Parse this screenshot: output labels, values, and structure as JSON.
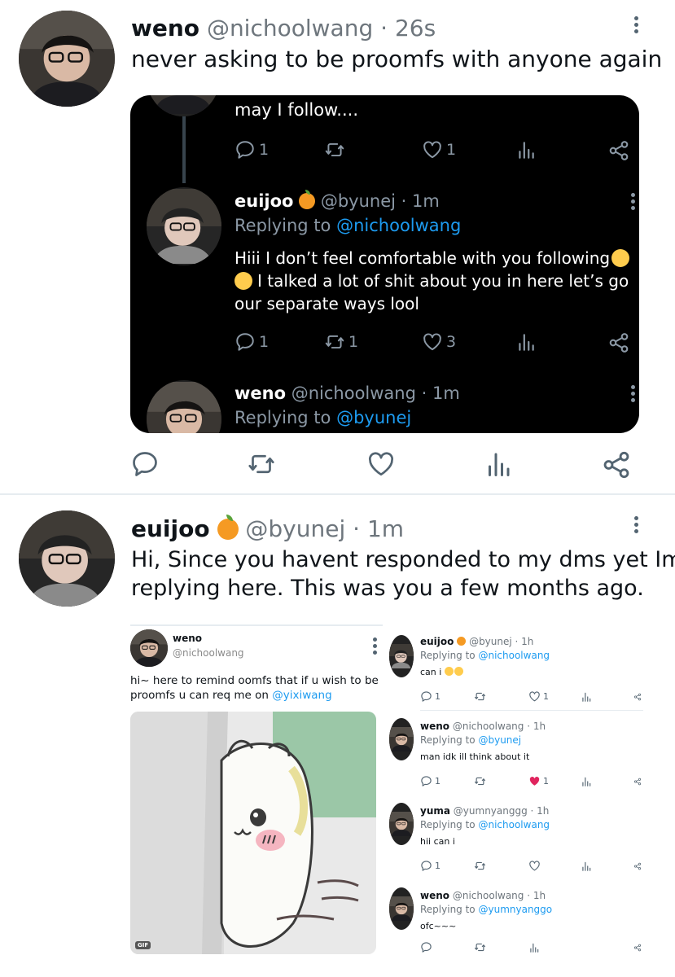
{
  "tweet1": {
    "name": "weno",
    "handle": "@nichoolwang",
    "time": "· 26s",
    "text": "never asking to be proomfs with anyone again",
    "quote": {
      "top_text": "may I follow....",
      "top_counts": {
        "reply": "1",
        "like": "1"
      },
      "reply1": {
        "name": "euijoo",
        "handle": "@byunej",
        "time": "· 1m",
        "replying_prefix": "Replying to",
        "replying_to": "@nichoolwang",
        "text_line1": "Hiii I don’t feel comfortable with you following",
        "text_line2": "I talked a lot of shit about you in here let’s go",
        "text_line3": "our separate ways lool",
        "counts": {
          "reply": "1",
          "retweet": "1",
          "like": "3"
        }
      },
      "reply2": {
        "name": "weno",
        "handle": "@nichoolwang",
        "time": "· 1m",
        "replying_prefix": "Replying to",
        "replying_to": "@byunej"
      }
    }
  },
  "tweet2": {
    "name": "euijoo",
    "handle": "@byunej",
    "time": "· 1m",
    "text_line1": "Hi, Since you havent responded to my dms yet Im",
    "text_line2": "replying here. This was you a few months ago.",
    "image_left": {
      "name": "weno",
      "handle": "@nichoolwang",
      "text_line1": "hi~ here to remind oomfs that if u wish to be",
      "text_line2_prefix": "proomfs u can req me on",
      "text_line2_link": "@yixiwang",
      "gif_label": "GIF"
    },
    "image_right": {
      "replying_prefix": "Replying to",
      "items": [
        {
          "name": "euijoo",
          "handle": "@byunej",
          "time": "· 1h",
          "replying_to": "@nichoolwang",
          "text": "can i",
          "reply": "1",
          "like": "1"
        },
        {
          "name": "weno",
          "handle": "@nichoolwang",
          "time": "· 1h",
          "replying_to": "@byunej",
          "text": "man idk ill think about it",
          "reply": "1",
          "like": "1"
        },
        {
          "name": "yuma",
          "handle": "@yumnyanggg",
          "time": "· 1h",
          "replying_to": "@nichoolwang",
          "text": "hii can i",
          "reply": "1",
          "like": ""
        },
        {
          "name": "weno",
          "handle": "@nichoolwang",
          "time": "· 1h",
          "replying_to": "@yumnyanggo",
          "text": "ofc~~~",
          "reply": "",
          "like": ""
        }
      ]
    }
  },
  "colors": {
    "link": "#1d9bf0",
    "dark_bg": "#000000",
    "heart_red": "#e0245e",
    "divider": "#e6ecf0"
  },
  "icons": [
    "reply-icon",
    "retweet-icon",
    "like-icon",
    "analytics-icon",
    "share-icon",
    "more-icon",
    "orange-emoji",
    "crying-emoji",
    "grin-emoji"
  ]
}
